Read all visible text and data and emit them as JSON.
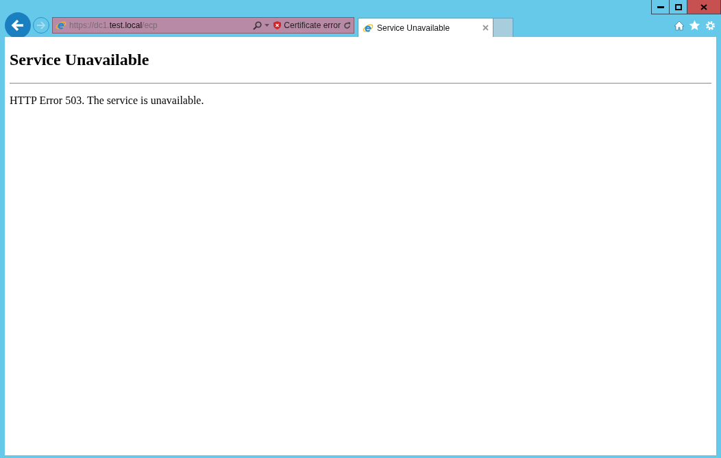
{
  "address_bar": {
    "url_prefix": "https://dc1.",
    "url_domain": "test.local",
    "url_suffix": "/ecp",
    "security_status": "Certificate error"
  },
  "tabs": [
    {
      "title": "Service Unavailable",
      "selected": true
    }
  ],
  "page": {
    "heading": "Service Unavailable",
    "message": "HTTP Error 503. The service is unavailable."
  }
}
